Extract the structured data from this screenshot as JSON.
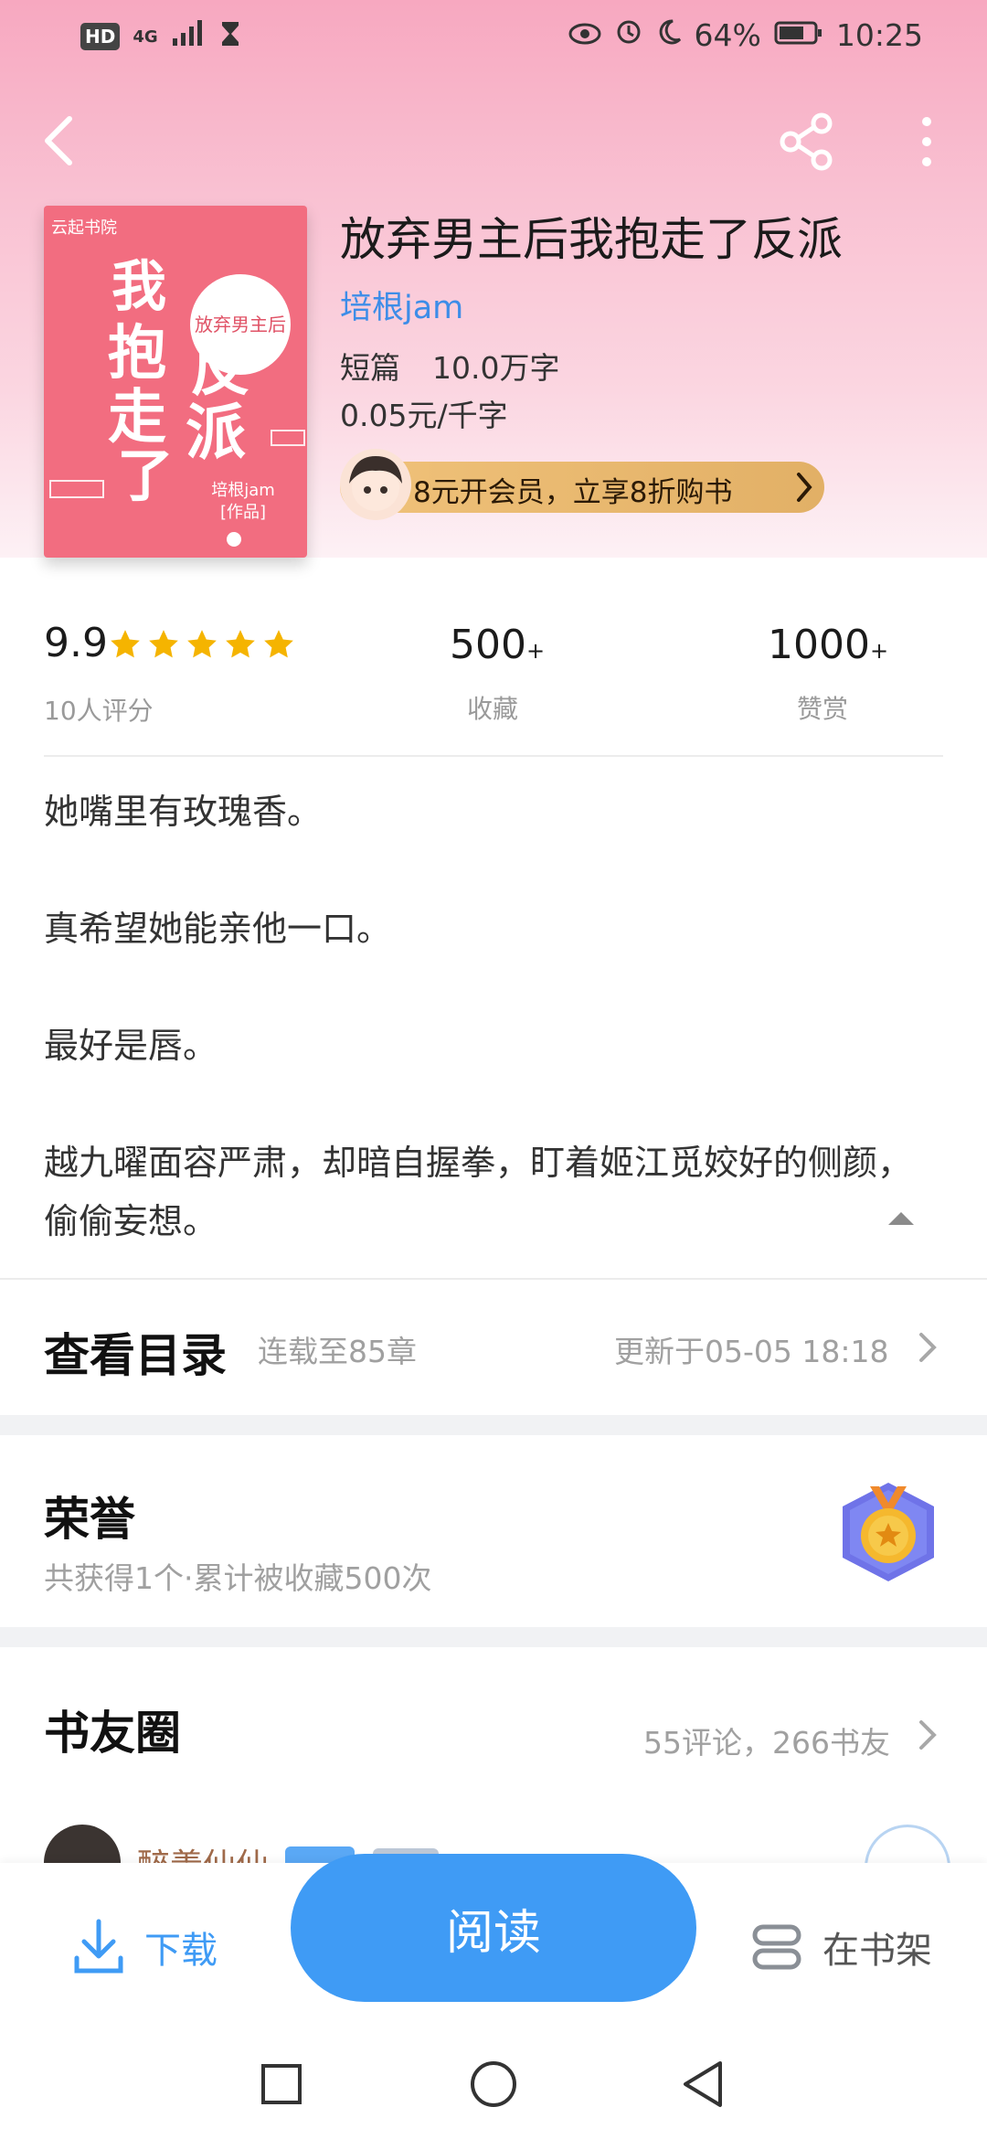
{
  "status_bar": {
    "hd": "HD",
    "network": "4G",
    "battery": "64%",
    "time": "10:25"
  },
  "book": {
    "title": "放弃男主后我抱走了反派",
    "author": "培根jam",
    "length_type": "短篇",
    "word_count": "10.0万字",
    "price": "0.05元/千字",
    "vip_promo": "8元开会员，立享8折购书"
  },
  "cover": {
    "publisher": "云起书院",
    "big_chars": [
      "我",
      "抱",
      "走",
      "了",
      "反",
      "派"
    ],
    "badge": "放弃男主后",
    "author_line": "培根jam\n[作品]",
    "color": "#f26d80"
  },
  "stats": {
    "rating": "9.9",
    "rating_label": "10人评分",
    "stars": 5,
    "favorites": "500",
    "favorites_plus": "+",
    "favorites_label": "收藏",
    "rewards": "1000",
    "rewards_plus": "+",
    "rewards_label": "赞赏"
  },
  "description": [
    "她嘴里有玫瑰香。",
    "真希望她能亲他一口。",
    "最好是唇。",
    "越九曜面容严肃，却暗自握拳，盯着姬江觅姣好的侧颜，偷偷妄想。"
  ],
  "catalog": {
    "title": "查看目录",
    "status": "连载至85章",
    "updated": "更新于05-05 18:18"
  },
  "honor": {
    "title": "荣誉",
    "subtitle": "共获得1个·累计被收藏500次"
  },
  "friends": {
    "title": "书友圈",
    "summary": "55评论，266书友",
    "first_user": "醉羡仙仙"
  },
  "bottom": {
    "download": "下载",
    "read": "阅读",
    "bookshelf": "在书架"
  },
  "colors": {
    "accent_blue": "#3f9bf5",
    "star": "#f5b400",
    "link_blue": "#3d8de8"
  }
}
